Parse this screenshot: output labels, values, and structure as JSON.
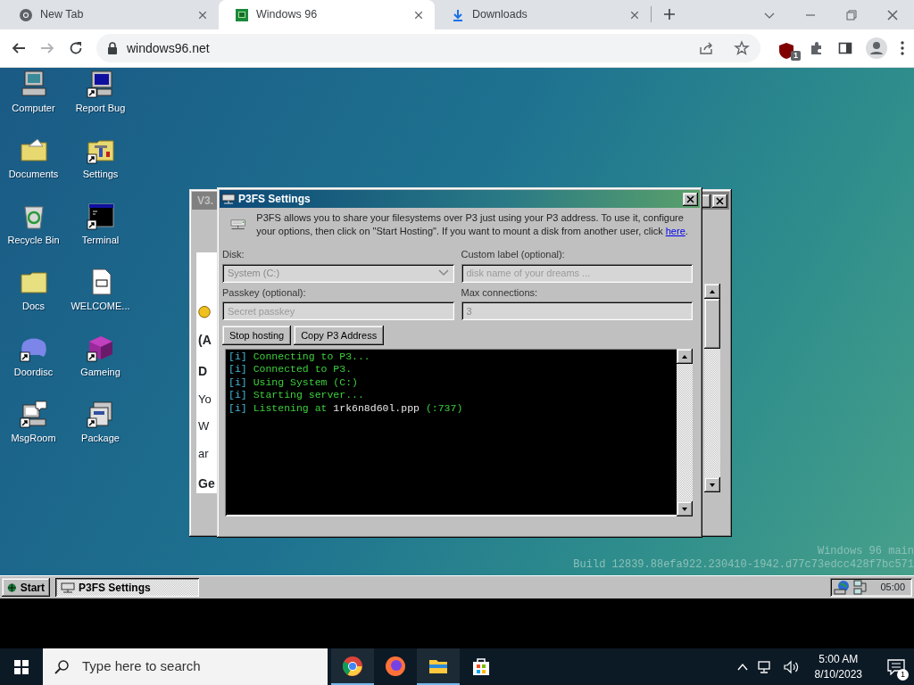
{
  "browser": {
    "tabs": [
      {
        "title": "New Tab",
        "kind": "chrome",
        "selected": false
      },
      {
        "title": "Windows 96",
        "kind": "app",
        "selected": true
      },
      {
        "title": "Downloads",
        "kind": "download",
        "selected": false
      }
    ],
    "address": "windows96.net",
    "extension_badge": "1"
  },
  "desktop": {
    "icons": [
      {
        "label": "Computer",
        "kind": "computer",
        "shortcut": false
      },
      {
        "label": "Report Bug",
        "kind": "monitor",
        "shortcut": true
      },
      {
        "label": "Documents",
        "kind": "documents",
        "shortcut": false
      },
      {
        "label": "Settings",
        "kind": "settings",
        "shortcut": true
      },
      {
        "label": "Recycle Bin",
        "kind": "recycle",
        "shortcut": false
      },
      {
        "label": "Terminal",
        "kind": "terminal",
        "shortcut": true
      },
      {
        "label": "Docs",
        "kind": "folder",
        "shortcut": false
      },
      {
        "label": "WELCOME...",
        "kind": "document",
        "shortcut": false
      },
      {
        "label": "Doordisc",
        "kind": "blob",
        "shortcut": true
      },
      {
        "label": "Gameing",
        "kind": "cube",
        "shortcut": true
      },
      {
        "label": "MsgRoom",
        "kind": "msg",
        "shortcut": true
      },
      {
        "label": "Package",
        "kind": "package",
        "shortcut": true
      }
    ],
    "watermark": [
      "Windows 96 main",
      "Build 12839.88efa922.230410-1942.d77c73edcc428f7bc571"
    ]
  },
  "back_window": {
    "title": "V3.",
    "lines": [
      {
        "text": "(A",
        "bold": true
      },
      {
        "text": "D",
        "bold": true
      },
      {
        "text": "Yo",
        "bold": false
      },
      {
        "text": "W",
        "bold": false
      },
      {
        "text": "ar",
        "bold": false
      },
      {
        "text": "Ge",
        "bold": true
      }
    ]
  },
  "dialog": {
    "title": "P3FS Settings",
    "description": "P3FS allows you to share your filesystems over P3 just using your P3 address. To use it, configure your options, then click on \"Start Hosting\". If you want to mount a disk from another user, click",
    "link": "here",
    "description_end": ".",
    "fields": [
      {
        "label": "Disk:",
        "kind": "select",
        "value": "System (C:)",
        "disabled": true
      },
      {
        "label": "Custom label (optional):",
        "kind": "text",
        "placeholder": "disk name of your dreams ...",
        "disabled": true
      },
      {
        "label": "Passkey (optional):",
        "kind": "text",
        "placeholder": "Secret passkey",
        "disabled": true
      },
      {
        "label": "Max connections:",
        "kind": "text",
        "value": "3",
        "disabled": true
      }
    ],
    "buttons": [
      "Stop hosting",
      "Copy P3 Address"
    ],
    "log": [
      {
        "tag": "[i]",
        "text": "Connecting to P3..."
      },
      {
        "tag": "[i]",
        "text": "Connected to P3."
      },
      {
        "tag": "[i]",
        "text": "Using System (C:)"
      },
      {
        "tag": "[i]",
        "text": "Starting server..."
      },
      {
        "tag": "[i]",
        "text": "Listening at",
        "address": "1rk6n8d60l.ppp",
        "suffix": "(:737)"
      }
    ]
  },
  "win96_taskbar": {
    "start": "Start",
    "tasks": [
      {
        "title": "P3FS Settings",
        "selected": true
      }
    ],
    "clock": "05:00"
  },
  "windows_taskbar": {
    "search_placeholder": "Type here to search",
    "apps": [
      {
        "kind": "chrome",
        "running": true
      },
      {
        "kind": "firefox",
        "running": false
      },
      {
        "kind": "explorer",
        "running": true
      },
      {
        "kind": "store",
        "running": false
      }
    ],
    "time": "5:00 AM",
    "date": "8/10/2023",
    "notification_count": "1"
  }
}
